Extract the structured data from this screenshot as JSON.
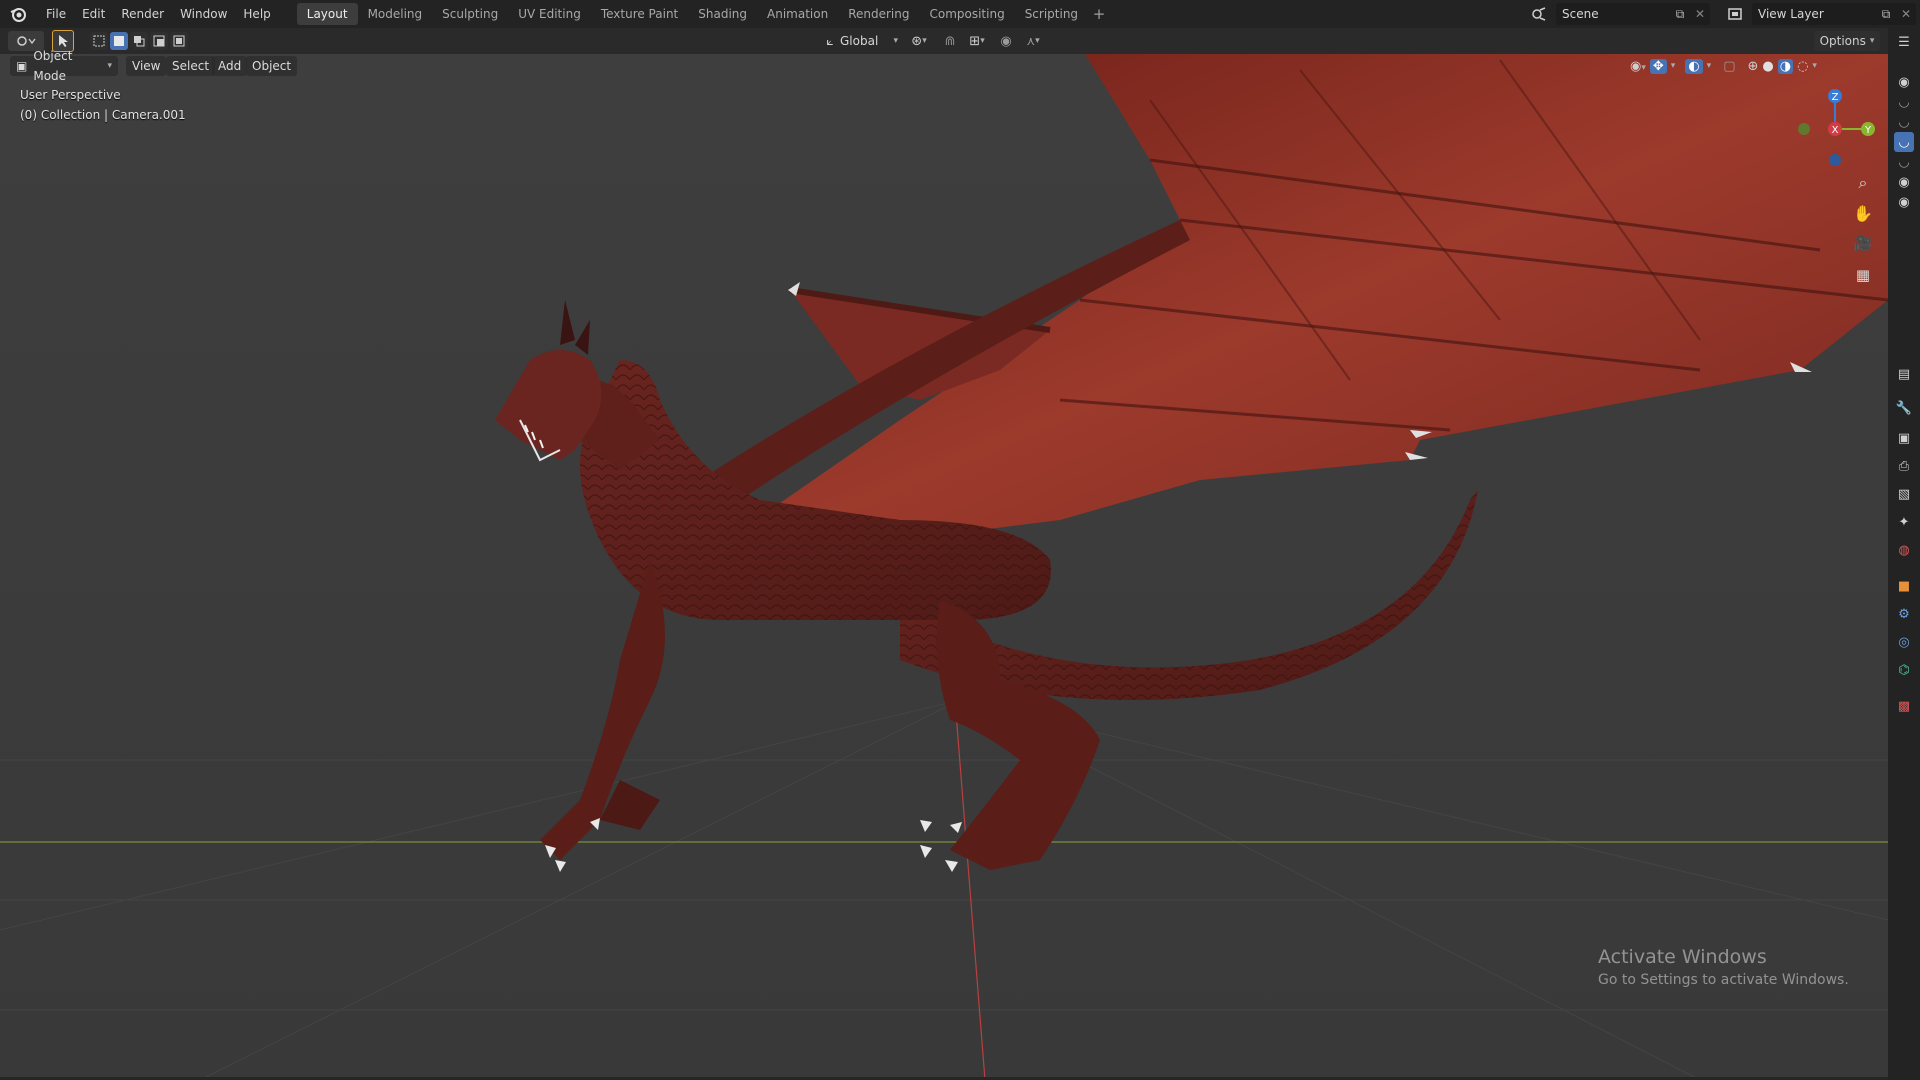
{
  "topbar": {
    "menus": [
      "File",
      "Edit",
      "Render",
      "Window",
      "Help"
    ],
    "workspaces": [
      {
        "label": "Layout",
        "active": true
      },
      {
        "label": "Modeling",
        "active": false
      },
      {
        "label": "Sculpting",
        "active": false
      },
      {
        "label": "UV Editing",
        "active": false
      },
      {
        "label": "Texture Paint",
        "active": false
      },
      {
        "label": "Shading",
        "active": false
      },
      {
        "label": "Animation",
        "active": false
      },
      {
        "label": "Rendering",
        "active": false
      },
      {
        "label": "Compositing",
        "active": false
      },
      {
        "label": "Scripting",
        "active": false
      }
    ],
    "add_tab": "+",
    "scene_name": "Scene",
    "view_layer": "View Layer"
  },
  "toolheader": {
    "orientation": "Global",
    "options_label": "Options"
  },
  "viewport_header": {
    "mode": "Object Mode",
    "menus": [
      "View",
      "Select",
      "Add",
      "Object"
    ]
  },
  "viewport": {
    "perspective_label": "User Perspective",
    "collection_label": "(0) Collection | Camera.001"
  },
  "gizmo": {
    "z": "Z",
    "x": "X",
    "y": "Y"
  },
  "watermark": {
    "title": "Activate Windows",
    "subtitle": "Go to Settings to activate Windows."
  },
  "colors": {
    "accent": "#4772b3",
    "dragon": "#7a2a22",
    "wing": "#9a3326",
    "x_axis": "#d13c45",
    "y_axis": "#8ab62e",
    "z_axis": "#3a7bd5"
  }
}
